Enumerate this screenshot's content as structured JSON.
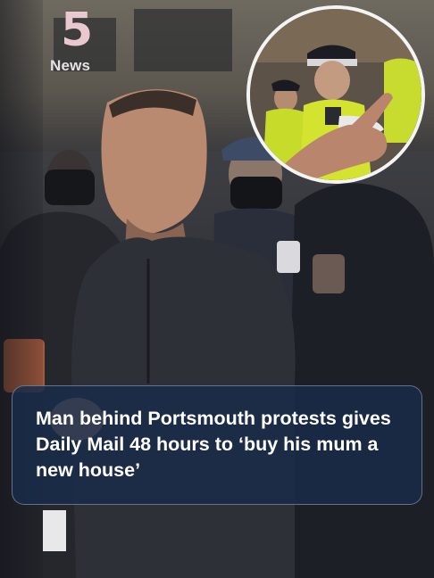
{
  "logo": {
    "number": "5",
    "word": "News"
  },
  "headline": "Man behind Portsmouth protests gives Daily Mail 48 hours to ‘buy his mum a new house’",
  "icons": {
    "logo": "channel-5-news-logo",
    "inset": "circular-inset-photo"
  }
}
